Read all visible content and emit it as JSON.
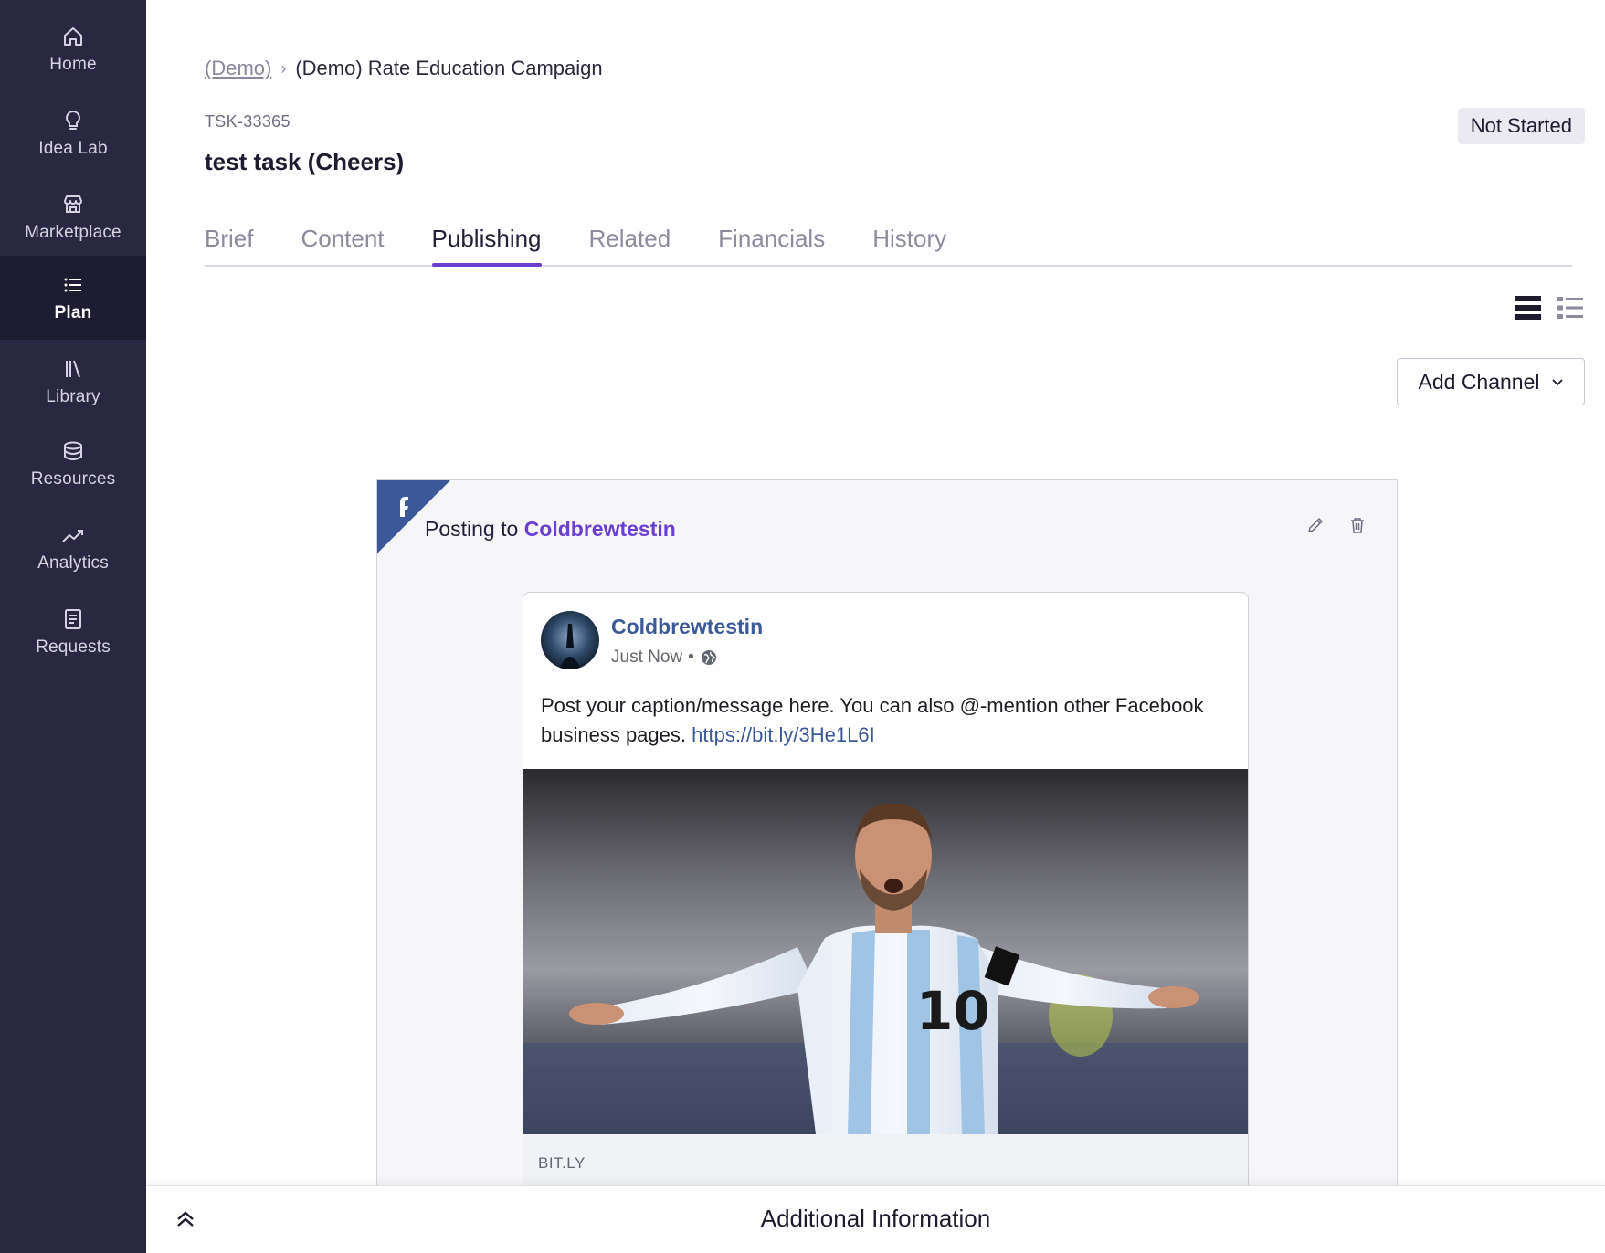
{
  "sidebar": {
    "items": [
      {
        "label": "Home",
        "icon": "home-icon"
      },
      {
        "label": "Idea Lab",
        "icon": "lightbulb-icon"
      },
      {
        "label": "Marketplace",
        "icon": "store-icon"
      },
      {
        "label": "Plan",
        "icon": "list-icon",
        "active": true
      },
      {
        "label": "Library",
        "icon": "library-icon"
      },
      {
        "label": "Resources",
        "icon": "database-icon"
      },
      {
        "label": "Analytics",
        "icon": "trend-icon"
      },
      {
        "label": "Requests",
        "icon": "document-icon"
      }
    ]
  },
  "breadcrumb": {
    "parent": "(Demo)",
    "separator": "›",
    "current": "(Demo) Rate Education Campaign"
  },
  "task": {
    "id": "TSK-33365",
    "title": "test task (Cheers)",
    "status": "Not Started"
  },
  "tabs": [
    {
      "label": "Brief"
    },
    {
      "label": "Content"
    },
    {
      "label": "Publishing",
      "active": true
    },
    {
      "label": "Related"
    },
    {
      "label": "Financials"
    },
    {
      "label": "History"
    }
  ],
  "toolbar": {
    "add_channel_label": "Add Channel"
  },
  "channel": {
    "network": "Facebook",
    "posting_prefix": "Posting to",
    "account": "Coldbrewtestin"
  },
  "fb_post": {
    "page_name": "Coldbrewtestin",
    "time": "Just Now",
    "dot": "•",
    "caption": "Post your caption/message here. You can also @-mention other Facebook business pages.",
    "link": "https://bit.ly/3He1L6I",
    "link_domain": "BIT.LY"
  },
  "bottom": {
    "title": "Additional Information"
  },
  "colors": {
    "sidebar_bg": "#2a2840",
    "accent": "#6b3fcf",
    "facebook": "#3b5998"
  }
}
